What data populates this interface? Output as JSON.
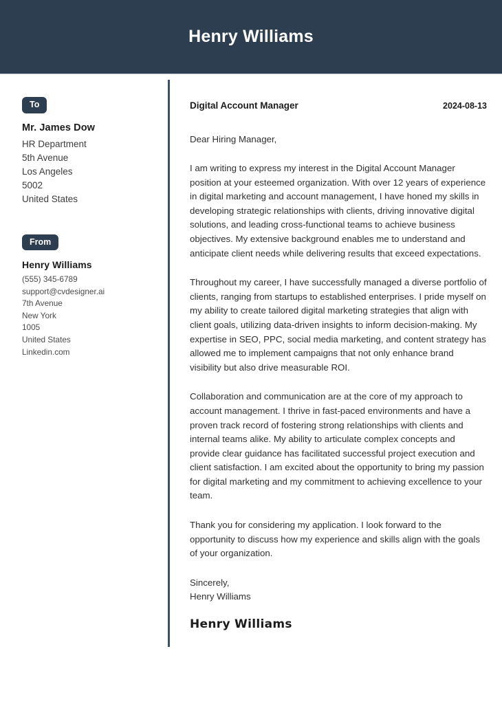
{
  "header": {
    "name": "Henry Williams",
    "background_color": "#2c3e50",
    "text_color": "#ffffff"
  },
  "sidebar": {
    "to": {
      "badge_label": "To",
      "name": "Mr. James Dow",
      "lines": [
        "HR Department",
        "5th Avenue",
        "Los Angeles",
        "5002",
        "United States"
      ]
    },
    "from": {
      "badge_label": "From",
      "name": "Henry Williams",
      "lines": [
        "(555) 345-6789",
        "support@cvdesigner.ai",
        "7th Avenue",
        "New York",
        "1005",
        "United States",
        "Linkedin.com"
      ]
    }
  },
  "letter": {
    "job_title": "Digital Account Manager",
    "date": "2024-08-13",
    "salutation": "Dear Hiring Manager,",
    "paragraphs": [
      "I am writing to express my interest in the Digital Account Manager position at your esteemed organization. With over 12 years of experience in digital marketing and account management, I have honed my skills in developing strategic relationships with clients, driving innovative digital solutions, and leading cross-functional teams to achieve business objectives. My extensive background enables me to understand and anticipate client needs while delivering results that exceed expectations.",
      "Throughout my career, I have successfully managed a diverse portfolio of clients, ranging from startups to established enterprises. I pride myself on my ability to create tailored digital marketing strategies that align with client goals, utilizing data-driven insights to inform decision-making. My expertise in SEO, PPC, social media marketing, and content strategy has allowed me to implement campaigns that not only enhance brand visibility but also drive measurable ROI.",
      "Collaboration and communication are at the core of my approach to account management. I thrive in fast-paced environments and have a proven track record of fostering strong relationships with clients and internal teams alike. My ability to articulate complex concepts and provide clear guidance has facilitated successful project execution and client satisfaction. I am excited about the opportunity to bring my passion for digital marketing and my commitment to achieving excellence to your team.",
      "Thank you for considering my application. I look forward to the opportunity to discuss how my experience and skills align with the goals of your organization."
    ],
    "closing_word": "Sincerely,",
    "closing_name": "Henry Williams",
    "signature": "Henry Williams"
  },
  "colors": {
    "accent": "#2c3e50",
    "divider": "#3d5066",
    "body_text": "#2f2f2f",
    "page_background": "#ffffff"
  }
}
